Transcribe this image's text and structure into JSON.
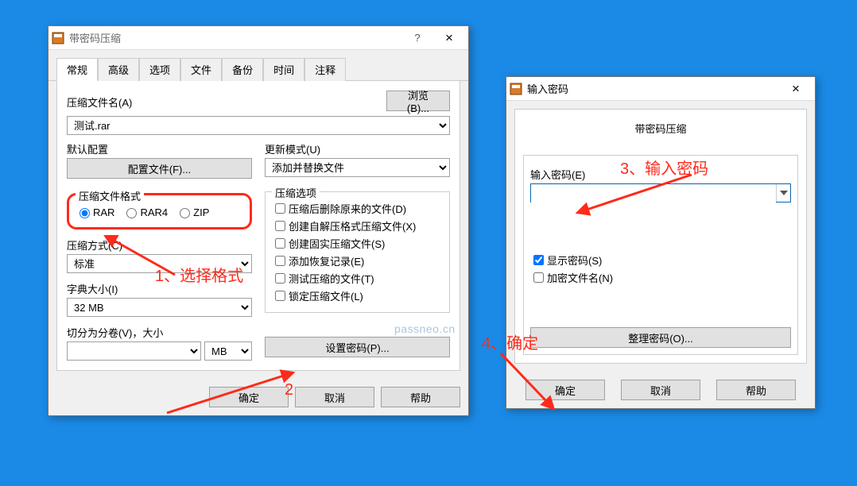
{
  "win1": {
    "title": "带密码压缩",
    "tabs": [
      "常规",
      "高级",
      "选项",
      "文件",
      "备份",
      "时间",
      "注释"
    ],
    "filename_label": "压缩文件名(A)",
    "filename_value": "测试.rar",
    "browse": "浏览(B)...",
    "default_cfg": "默认配置",
    "profile_btn": "配置文件(F)...",
    "format_group": "压缩文件格式",
    "format": {
      "rar": "RAR",
      "rar4": "RAR4",
      "zip": "ZIP"
    },
    "method_label": "压缩方式(C)",
    "method_value": "标准",
    "dict_label": "字典大小(I)",
    "dict_value": "32 MB",
    "split_label": "切分为分卷(V)，大小",
    "split_unit": "MB",
    "update_label": "更新模式(U)",
    "update_value": "添加并替换文件",
    "opts_group": "压缩选项",
    "opt1": "压缩后删除原来的文件(D)",
    "opt2": "创建自解压格式压缩文件(X)",
    "opt3": "创建固实压缩文件(S)",
    "opt4": "添加恢复记录(E)",
    "opt5": "测试压缩的文件(T)",
    "opt6": "锁定压缩文件(L)",
    "setpw": "设置密码(P)...",
    "ok": "确定",
    "cancel": "取消",
    "help": "帮助"
  },
  "win2": {
    "title": "输入密码",
    "header": "带密码压缩",
    "pw_label": "输入密码(E)",
    "show_pw": "显示密码(S)",
    "enc_name": "加密文件名(N)",
    "manage": "整理密码(O)...",
    "ok": "确定",
    "cancel": "取消",
    "help": "帮助"
  },
  "annotations": {
    "a1": "1、选择格式",
    "a2": "2",
    "a3": "3、输入密码",
    "a4": "4、确定"
  },
  "watermark": "passneo.cn"
}
